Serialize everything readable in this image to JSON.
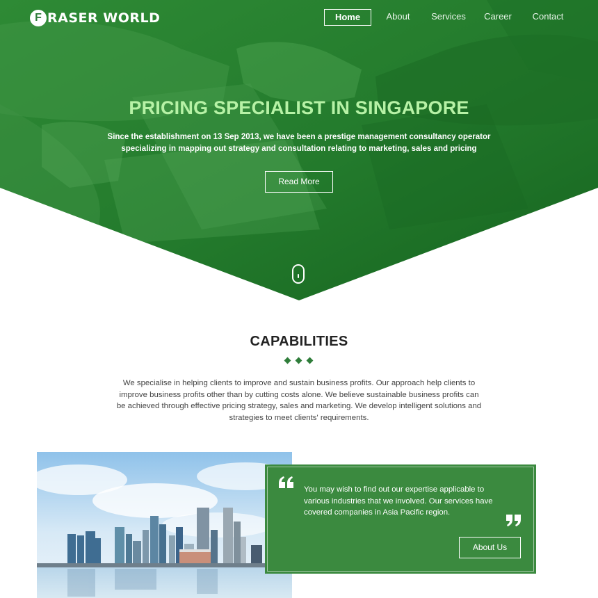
{
  "brand": {
    "logo_letter": "F",
    "name": "RASER WORLD"
  },
  "nav": {
    "items": [
      {
        "label": "Home",
        "active": true
      },
      {
        "label": "About",
        "active": false
      },
      {
        "label": "Services",
        "active": false
      },
      {
        "label": "Career",
        "active": false
      },
      {
        "label": "Contact",
        "active": false
      }
    ]
  },
  "hero": {
    "title": "PRICING SPECIALIST IN SINGAPORE",
    "subtitle": "Since the establishment on 13 Sep 2013, we have been a prestige management consultancy operator specializing in mapping out strategy and consultation relating to marketing, sales and pricing",
    "button_label": "Read More"
  },
  "capabilities": {
    "title": "CAPABILITIES",
    "body": "We specialise in helping clients to improve and sustain business profits. Our approach help clients to improve business profits other than by cutting costs alone. We believe sustainable business profits can be achieved through effective pricing strategy, sales and marketing. We develop intelligent solutions and strategies to meet clients' requirements."
  },
  "quote": {
    "text": "You may wish to find out our expertise applicable to various industries that we involved. Our services have covered companies in Asia Pacific region.",
    "button_label": "About Us"
  },
  "colors": {
    "brand_green": "#2f7d3a",
    "hero_overlay": "#1f7a2a",
    "title_green": "#b7f2a6",
    "quote_bg": "#3b8a3f"
  }
}
